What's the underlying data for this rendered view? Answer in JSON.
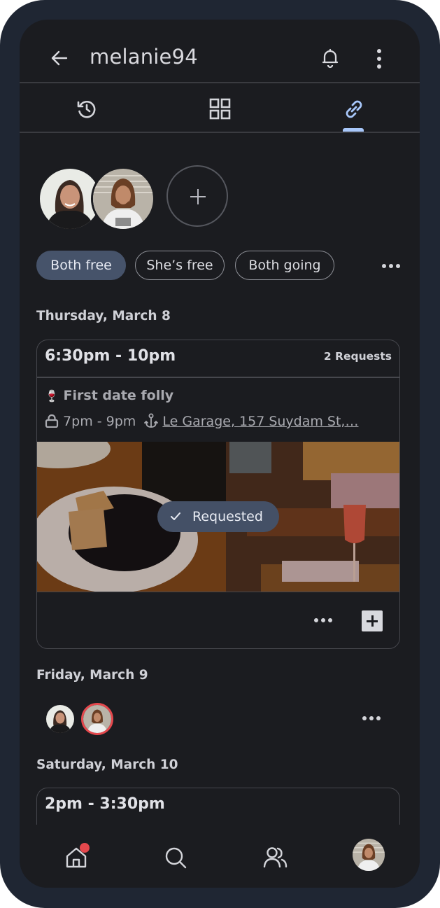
{
  "appbar": {
    "title": "melanie94",
    "icons": [
      "back-arrow-icon",
      "bell-icon",
      "more-vert-icon"
    ]
  },
  "tabs": [
    {
      "icon": "history-icon",
      "active": false
    },
    {
      "icon": "grid-icon",
      "active": false
    },
    {
      "icon": "link-icon",
      "active": true
    }
  ],
  "colors": {
    "accent": "#a8c7fa",
    "active_chip": "#46536a",
    "badge": "#e5484d",
    "frame": "#1f2633",
    "screen": "#1b1c20"
  },
  "people": {
    "avatars": [
      "melanie-avatar",
      "partner-avatar"
    ],
    "add_icon": "plus-icon"
  },
  "filters": {
    "chips": [
      {
        "label": "Both free",
        "active": true
      },
      {
        "label": "She’s free",
        "active": false
      },
      {
        "label": "Both going",
        "active": false
      }
    ],
    "more_icon": "more-horiz-icon"
  },
  "days": [
    {
      "date": "Thursday, March 8",
      "slot": {
        "time": "6:30pm - 10pm",
        "requests": "2 Requests",
        "event": {
          "emoji": "🍷",
          "title": "First date folly",
          "time": "7pm - 9pm",
          "location": "Le Garage, 157 Suydam St,…",
          "status": "Requested"
        }
      }
    },
    {
      "date": "Friday, March 9"
    },
    {
      "date": "Saturday, March 10",
      "slot": {
        "time": "2pm - 3:30pm"
      }
    }
  ],
  "bottom_nav": [
    {
      "icon": "home-icon",
      "badge": true
    },
    {
      "icon": "search-icon",
      "badge": false
    },
    {
      "icon": "people-icon",
      "badge": false
    },
    {
      "icon": "profile-avatar",
      "badge": false
    }
  ]
}
